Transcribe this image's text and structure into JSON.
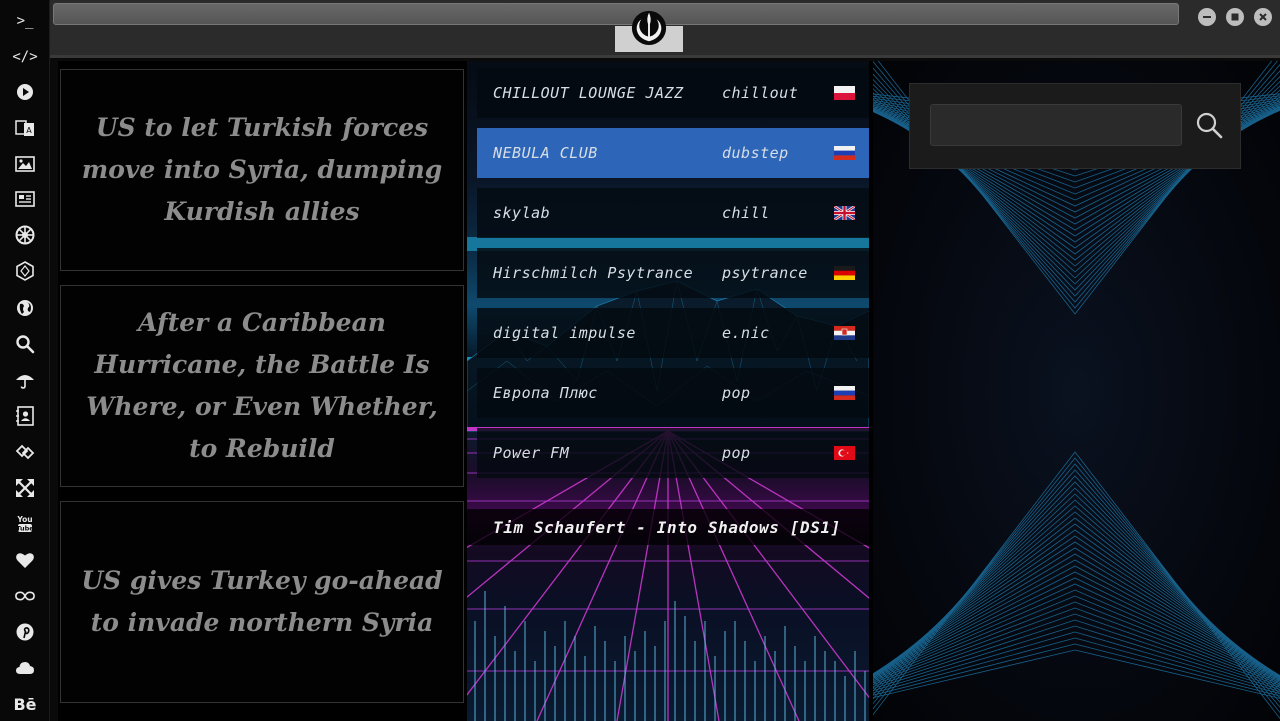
{
  "sidebar": {
    "items": [
      {
        "icon": "terminal-icon",
        "label": ">_"
      },
      {
        "icon": "code-icon",
        "label": "</>"
      },
      {
        "icon": "play-icon"
      },
      {
        "icon": "translate-icon"
      },
      {
        "icon": "image-icon"
      },
      {
        "icon": "newspaper-icon"
      },
      {
        "icon": "empire-icon"
      },
      {
        "icon": "hexagon-icon"
      },
      {
        "icon": "globe-icon"
      },
      {
        "icon": "search-icon"
      },
      {
        "icon": "umbrella-icon"
      },
      {
        "icon": "contacts-icon"
      },
      {
        "icon": "links-icon"
      },
      {
        "icon": "expand-icon"
      },
      {
        "icon": "youtube-icon",
        "label": "You Tube"
      },
      {
        "icon": "heart-icon"
      },
      {
        "icon": "infinity-icon"
      },
      {
        "icon": "pinterest-icon"
      },
      {
        "icon": "cloud-icon"
      },
      {
        "icon": "behance-icon",
        "label": "Bē"
      }
    ]
  },
  "topbar": {
    "logo_icon": "rebel-alliance-icon",
    "window_buttons": [
      "minimize-icon",
      "maximize-icon",
      "close-icon"
    ]
  },
  "news": [
    {
      "title": "US to let Turkish forces move into Syria, dumping Kurdish allies"
    },
    {
      "title": "After a Caribbean Hurricane, the Battle Is Where, or Even Whether, to Rebuild"
    },
    {
      "title": "US gives Turkey go-ahead to invade northern Syria"
    }
  ],
  "radio": {
    "stations": [
      {
        "name": "CHILLOUT LOUNGE JAZZ",
        "genre": "chillout",
        "flag": "poland-flag",
        "active": false
      },
      {
        "name": "NEBULA CLUB",
        "genre": "dubstep",
        "flag": "russia-flag",
        "active": true
      },
      {
        "name": "skylab",
        "genre": "chill",
        "flag": "uk-flag",
        "active": false
      },
      {
        "name": "Hirschmilch Psytrance",
        "genre": "psytrance",
        "flag": "germany-flag",
        "active": false
      },
      {
        "name": "digital impulse",
        "genre": "e.nic",
        "flag": "croatia-flag",
        "active": false
      },
      {
        "name": "Европа Плюс",
        "genre": "pop",
        "flag": "russia-flag",
        "active": false
      },
      {
        "name": "Power FM",
        "genre": "pop",
        "flag": "turkey-flag",
        "active": false
      }
    ],
    "now_playing": "Tim Schaufert - Into Shadows [DS1]"
  },
  "search": {
    "placeholder": "",
    "value": "",
    "button_icon": "search-icon"
  },
  "colors": {
    "active_station": "#2d66b8",
    "accent_cyan": "#1fb6e6",
    "accent_magenta": "#d63ad8"
  }
}
